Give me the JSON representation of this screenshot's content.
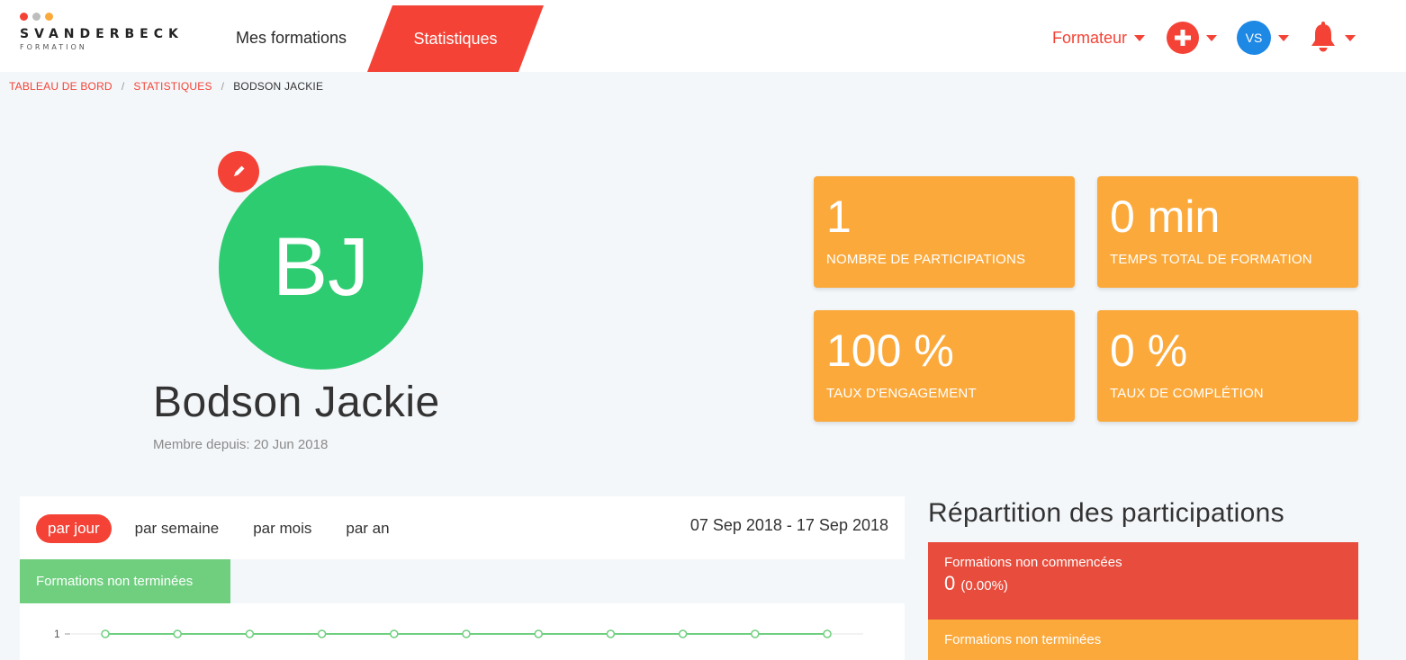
{
  "app": {
    "logo_word": "SVANDERBECK",
    "logo_sub": "FORMATION",
    "logo_dot_colors": [
      "#f44336",
      "#bdbdbd",
      "#fba93b"
    ]
  },
  "nav": {
    "mes_formations": "Mes formations",
    "statistiques": "Statistiques",
    "role": "Formateur",
    "user_initials": "VS",
    "icons": [
      "plus-icon",
      "bell-icon",
      "caret-down-icon"
    ]
  },
  "breadcrumb": {
    "items": [
      "TABLEAU DE BORD",
      "STATISTIQUES"
    ],
    "separator": "/",
    "current": "BODSON JACKIE"
  },
  "profile": {
    "initials": "BJ",
    "name": "Bodson Jackie",
    "member_since": "Membre depuis: 20 Jun 2018",
    "avatar_color": "#2ecc71"
  },
  "kpis": [
    {
      "value": "1",
      "label": "NOMBRE DE PARTICIPATIONS"
    },
    {
      "value": "0 min",
      "label": "TEMPS TOTAL DE FORMATION"
    },
    {
      "value": "100 %",
      "label": "TAUX D'ENGAGEMENT"
    },
    {
      "value": "0 %",
      "label": "TAUX DE COMPLÉTION"
    }
  ],
  "chart": {
    "periods": [
      "par jour",
      "par semaine",
      "par mois",
      "par an"
    ],
    "active_period": "par jour",
    "date_range": "07 Sep 2018 - 17 Sep 2018",
    "legend_label": "Formations non terminées",
    "y_tick": "1",
    "series_color": "#6fcf7f",
    "values": [
      1,
      1,
      1,
      1,
      1,
      1,
      1,
      1,
      1,
      1,
      1
    ]
  },
  "distribution": {
    "title": "Répartition des participations",
    "items": [
      {
        "label": "Formations non commencées",
        "value": "0",
        "percent": "(0.00%)",
        "color": "#e74c3c"
      },
      {
        "label": "Formations non terminées",
        "value": "",
        "percent": "",
        "color": "#fba93b"
      }
    ]
  },
  "colors": {
    "accent": "#f44336",
    "kpi": "#fba93b",
    "avatar_blue": "#1e88e5"
  }
}
